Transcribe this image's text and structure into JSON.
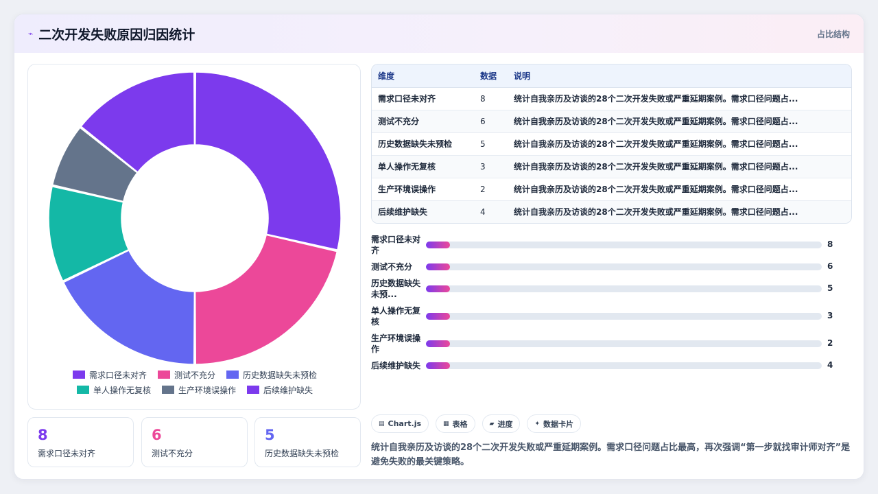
{
  "header": {
    "title": "二次开发失败原因归因统计",
    "right_label": "占比结构"
  },
  "chart_data": {
    "type": "pie",
    "variant": "donut",
    "categories": [
      "需求口径未对齐",
      "测试不充分",
      "历史数据缺失未预检",
      "单人操作无复核",
      "生产环境误操作",
      "后续维护缺失"
    ],
    "values": [
      8,
      6,
      5,
      3,
      2,
      4
    ],
    "colors": [
      "#7c3aed",
      "#ec4899",
      "#6366f1",
      "#14b8a6",
      "#64748b",
      "#7c3aed"
    ],
    "legend": "bottom"
  },
  "kpis": [
    {
      "value": "8",
      "label": "需求口径未对齐",
      "color": "#7c3aed"
    },
    {
      "value": "6",
      "label": "测试不充分",
      "color": "#ec4899"
    },
    {
      "value": "5",
      "label": "历史数据缺失未预检",
      "color": "#6366f1"
    }
  ],
  "table": {
    "headers": [
      "维度",
      "数据",
      "说明"
    ],
    "rows": [
      [
        "需求口径未对齐",
        "8",
        "统计自我亲历及访谈的28个二次开发失败或严重延期案例。需求口径问题占..."
      ],
      [
        "测试不充分",
        "6",
        "统计自我亲历及访谈的28个二次开发失败或严重延期案例。需求口径问题占..."
      ],
      [
        "历史数据缺失未预检",
        "5",
        "统计自我亲历及访谈的28个二次开发失败或严重延期案例。需求口径问题占..."
      ],
      [
        "单人操作无复核",
        "3",
        "统计自我亲历及访谈的28个二次开发失败或严重延期案例。需求口径问题占..."
      ],
      [
        "生产环境误操作",
        "2",
        "统计自我亲历及访谈的28个二次开发失败或严重延期案例。需求口径问题占..."
      ],
      [
        "后续维护缺失",
        "4",
        "统计自我亲历及访谈的28个二次开发失败或严重延期案例。需求口径问题占..."
      ]
    ]
  },
  "bars": [
    {
      "label": "需求口径未对齐",
      "value": 8
    },
    {
      "label": "测试不充分",
      "value": 6
    },
    {
      "label": "历史数据缺失未预...",
      "value": 5
    },
    {
      "label": "单人操作无复核",
      "value": 3
    },
    {
      "label": "生产环境误操作",
      "value": 2
    },
    {
      "label": "后续维护缺失",
      "value": 4
    }
  ],
  "tags": [
    {
      "icon": "chart-icon",
      "label": "Chart.js"
    },
    {
      "icon": "table-icon",
      "label": "表格"
    },
    {
      "icon": "progress-icon",
      "label": "进度"
    },
    {
      "icon": "sparkle-icon",
      "label": "数据卡片"
    }
  ],
  "note": "统计自我亲历及访谈的28个二次开发失败或严重延期案例。需求口径问题占比最高，再次强调“第一步就找审计师对齐”是避免失败的最关键策略。"
}
